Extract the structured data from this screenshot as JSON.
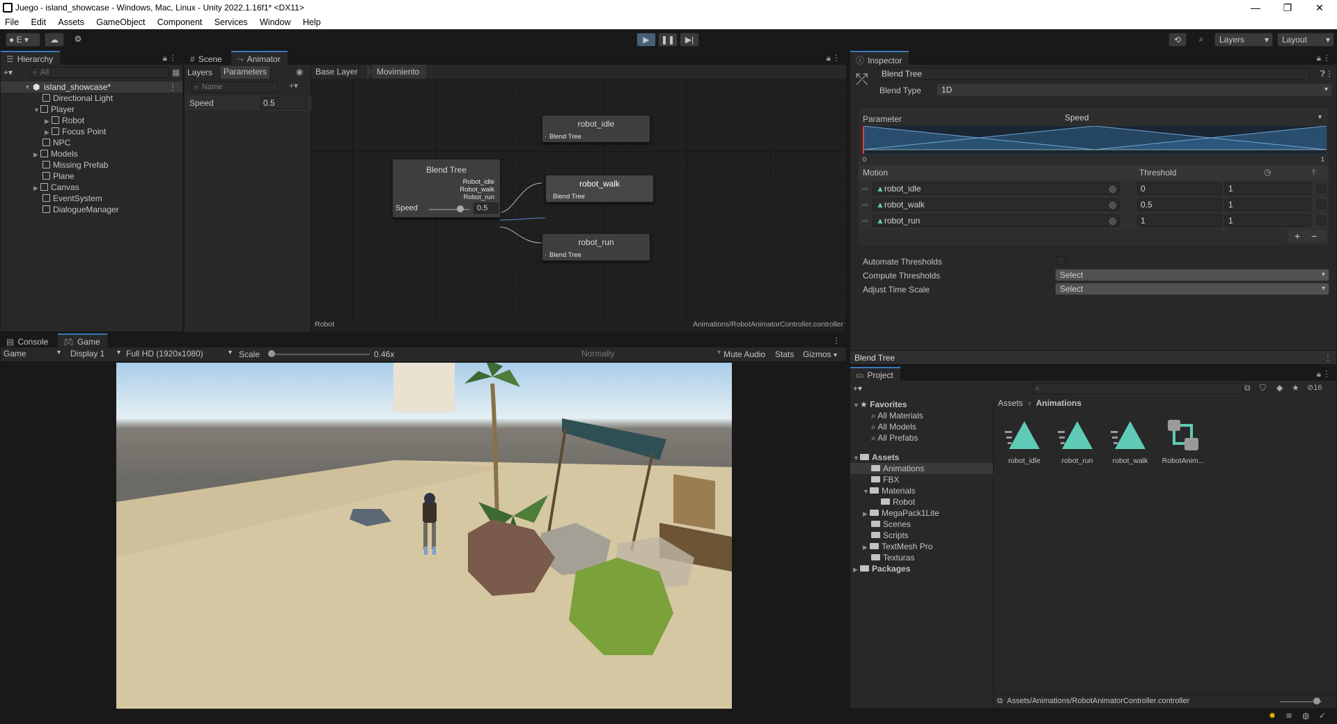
{
  "window": {
    "title": "Juego - island_showcase - Windows, Mac, Linux - Unity 2022.1.16f1* <DX11>"
  },
  "menu": [
    "File",
    "Edit",
    "Assets",
    "GameObject",
    "Component",
    "Services",
    "Window",
    "Help"
  ],
  "toolbar": {
    "account_label": "E",
    "layers_label": "Layers",
    "layout_label": "Layout"
  },
  "hierarchy": {
    "tab": "Hierarchy",
    "search_placeholder": "All",
    "scene": "island_showcase*",
    "items": [
      "Directional Light",
      "Player",
      "Robot",
      "Focus Point",
      "NPC",
      "Models",
      "Missing Prefab",
      "Plane",
      "Canvas",
      "EventSystem",
      "DialogueManager"
    ]
  },
  "animator": {
    "tabs": [
      "Scene",
      "Animator"
    ],
    "subtabs": [
      "Layers",
      "Parameters"
    ],
    "breadcrumbs": [
      "Base Layer",
      "Movimiento"
    ],
    "param_search_placeholder": "Name",
    "param_name": "Speed",
    "param_value": "0.5",
    "blend_tree": {
      "title": "Blend Tree",
      "outputs": [
        "Robot_idle",
        "Robot_walk",
        "Robot_run"
      ],
      "param": "Speed",
      "value": "0.5"
    },
    "nodes": [
      {
        "title": "robot_idle",
        "sub": "Blend Tree"
      },
      {
        "title": "robot_walk",
        "sub": "Blend Tree"
      },
      {
        "title": "robot_run",
        "sub": "Blend Tree"
      }
    ],
    "footer_left": "Robot",
    "footer_right": "Animations/RobotAnimatorController.controller"
  },
  "inspector": {
    "tab": "Inspector",
    "name": "Blend Tree",
    "blend_type_label": "Blend Type",
    "blend_type": "1D",
    "parameter_label": "Parameter",
    "parameter": "Speed",
    "graph_min": "0",
    "graph_max": "1",
    "motion_header": "Motion",
    "threshold_header": "Threshold",
    "motions": [
      {
        "name": "robot_idle",
        "threshold": "0",
        "speed": "1"
      },
      {
        "name": "robot_walk",
        "threshold": "0.5",
        "speed": "1"
      },
      {
        "name": "robot_run",
        "threshold": "1",
        "speed": "1"
      }
    ],
    "automate_label": "Automate Thresholds",
    "compute_label": "Compute Thresholds",
    "compute_value": "Select",
    "adjust_label": "Adjust Time Scale",
    "adjust_value": "Select",
    "footer": "Blend Tree"
  },
  "game": {
    "tabs": [
      "Console",
      "Game"
    ],
    "mode": "Game",
    "display": "Display 1",
    "resolution": "Full HD (1920x1080)",
    "scale_label": "Scale",
    "scale_value": "0.46x",
    "play_mode": "Normally",
    "scale_fraction": 0.0,
    "buttons": [
      "Mute Audio",
      "Stats",
      "Gizmos"
    ]
  },
  "project": {
    "tab": "Project",
    "hidden_count": "16",
    "favorites_label": "Favorites",
    "favorites": [
      "All Materials",
      "All Models",
      "All Prefabs"
    ],
    "assets_label": "Assets",
    "folders": [
      "Animations",
      "FBX",
      "Materials",
      "Robot",
      "MegaPack1Lite",
      "Scenes",
      "Scripts",
      "TextMesh Pro",
      "Texturas"
    ],
    "packages_label": "Packages",
    "breadcrumb": [
      "Assets",
      "Animations"
    ],
    "files": [
      "robot_idle",
      "robot_run",
      "robot_walk",
      "RobotAnim..."
    ],
    "footer_path": "Assets/Animations/RobotAnimatorController.controller"
  },
  "colors": {
    "accent": "#3a79bb",
    "anim_icon": "#5fcbb7",
    "play_active": "#46607c"
  }
}
